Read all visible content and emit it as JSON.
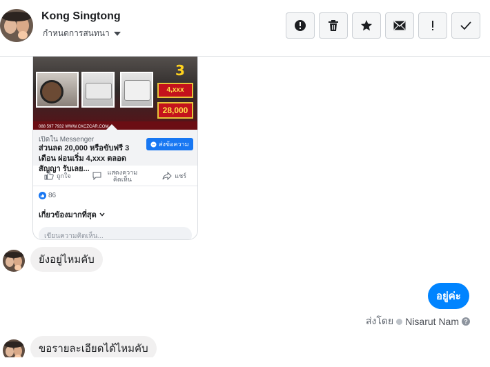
{
  "header": {
    "name": "Kong Singtong",
    "subtitle": "กำหนดการสนทนา",
    "toolbar": [
      {
        "icon": "alert-icon"
      },
      {
        "icon": "trash-icon"
      },
      {
        "icon": "star-icon"
      },
      {
        "icon": "mail-icon"
      },
      {
        "icon": "important-icon"
      },
      {
        "icon": "check-icon"
      }
    ]
  },
  "shared_post": {
    "image_big_text": "3",
    "image_price_1": "4,xxx",
    "image_price_2": "28,000",
    "image_footer": "088 597 7932 WWW.CKCZCAR.COM",
    "source": "เปิดใน Messenger",
    "title": "ส่วนลด 20,000 หรือขับฟรี 3 เดือน ผ่อนเริ่ม 4,xxx ตลอดสัญญา รับเลย...",
    "send_button": "ส่งข้อความ",
    "like_label": "ถูกใจ",
    "comment_label": "แสดงความคิดเห็น",
    "share_label": "แชร์",
    "like_count": "86",
    "most_relevant": "เกี่ยวข้องมากที่สุด",
    "comment_placeholder": "เขียนความคิดเห็น..."
  },
  "messages": [
    {
      "from": "them",
      "text": "ยังอยู่ไหมคับ"
    },
    {
      "from": "me",
      "text": "อยู่ค่ะ"
    },
    {
      "from": "them",
      "text": "ขอรายละเอียดได้ไหมคับ"
    }
  ],
  "sent_by": {
    "prefix": "ส่งโดย",
    "name": "Nisarut Nam",
    "help": "?"
  },
  "colors": {
    "accent": "#0084ff",
    "incoming_bubble": "#f1f0f0",
    "facebook_blue": "#1877f2"
  }
}
